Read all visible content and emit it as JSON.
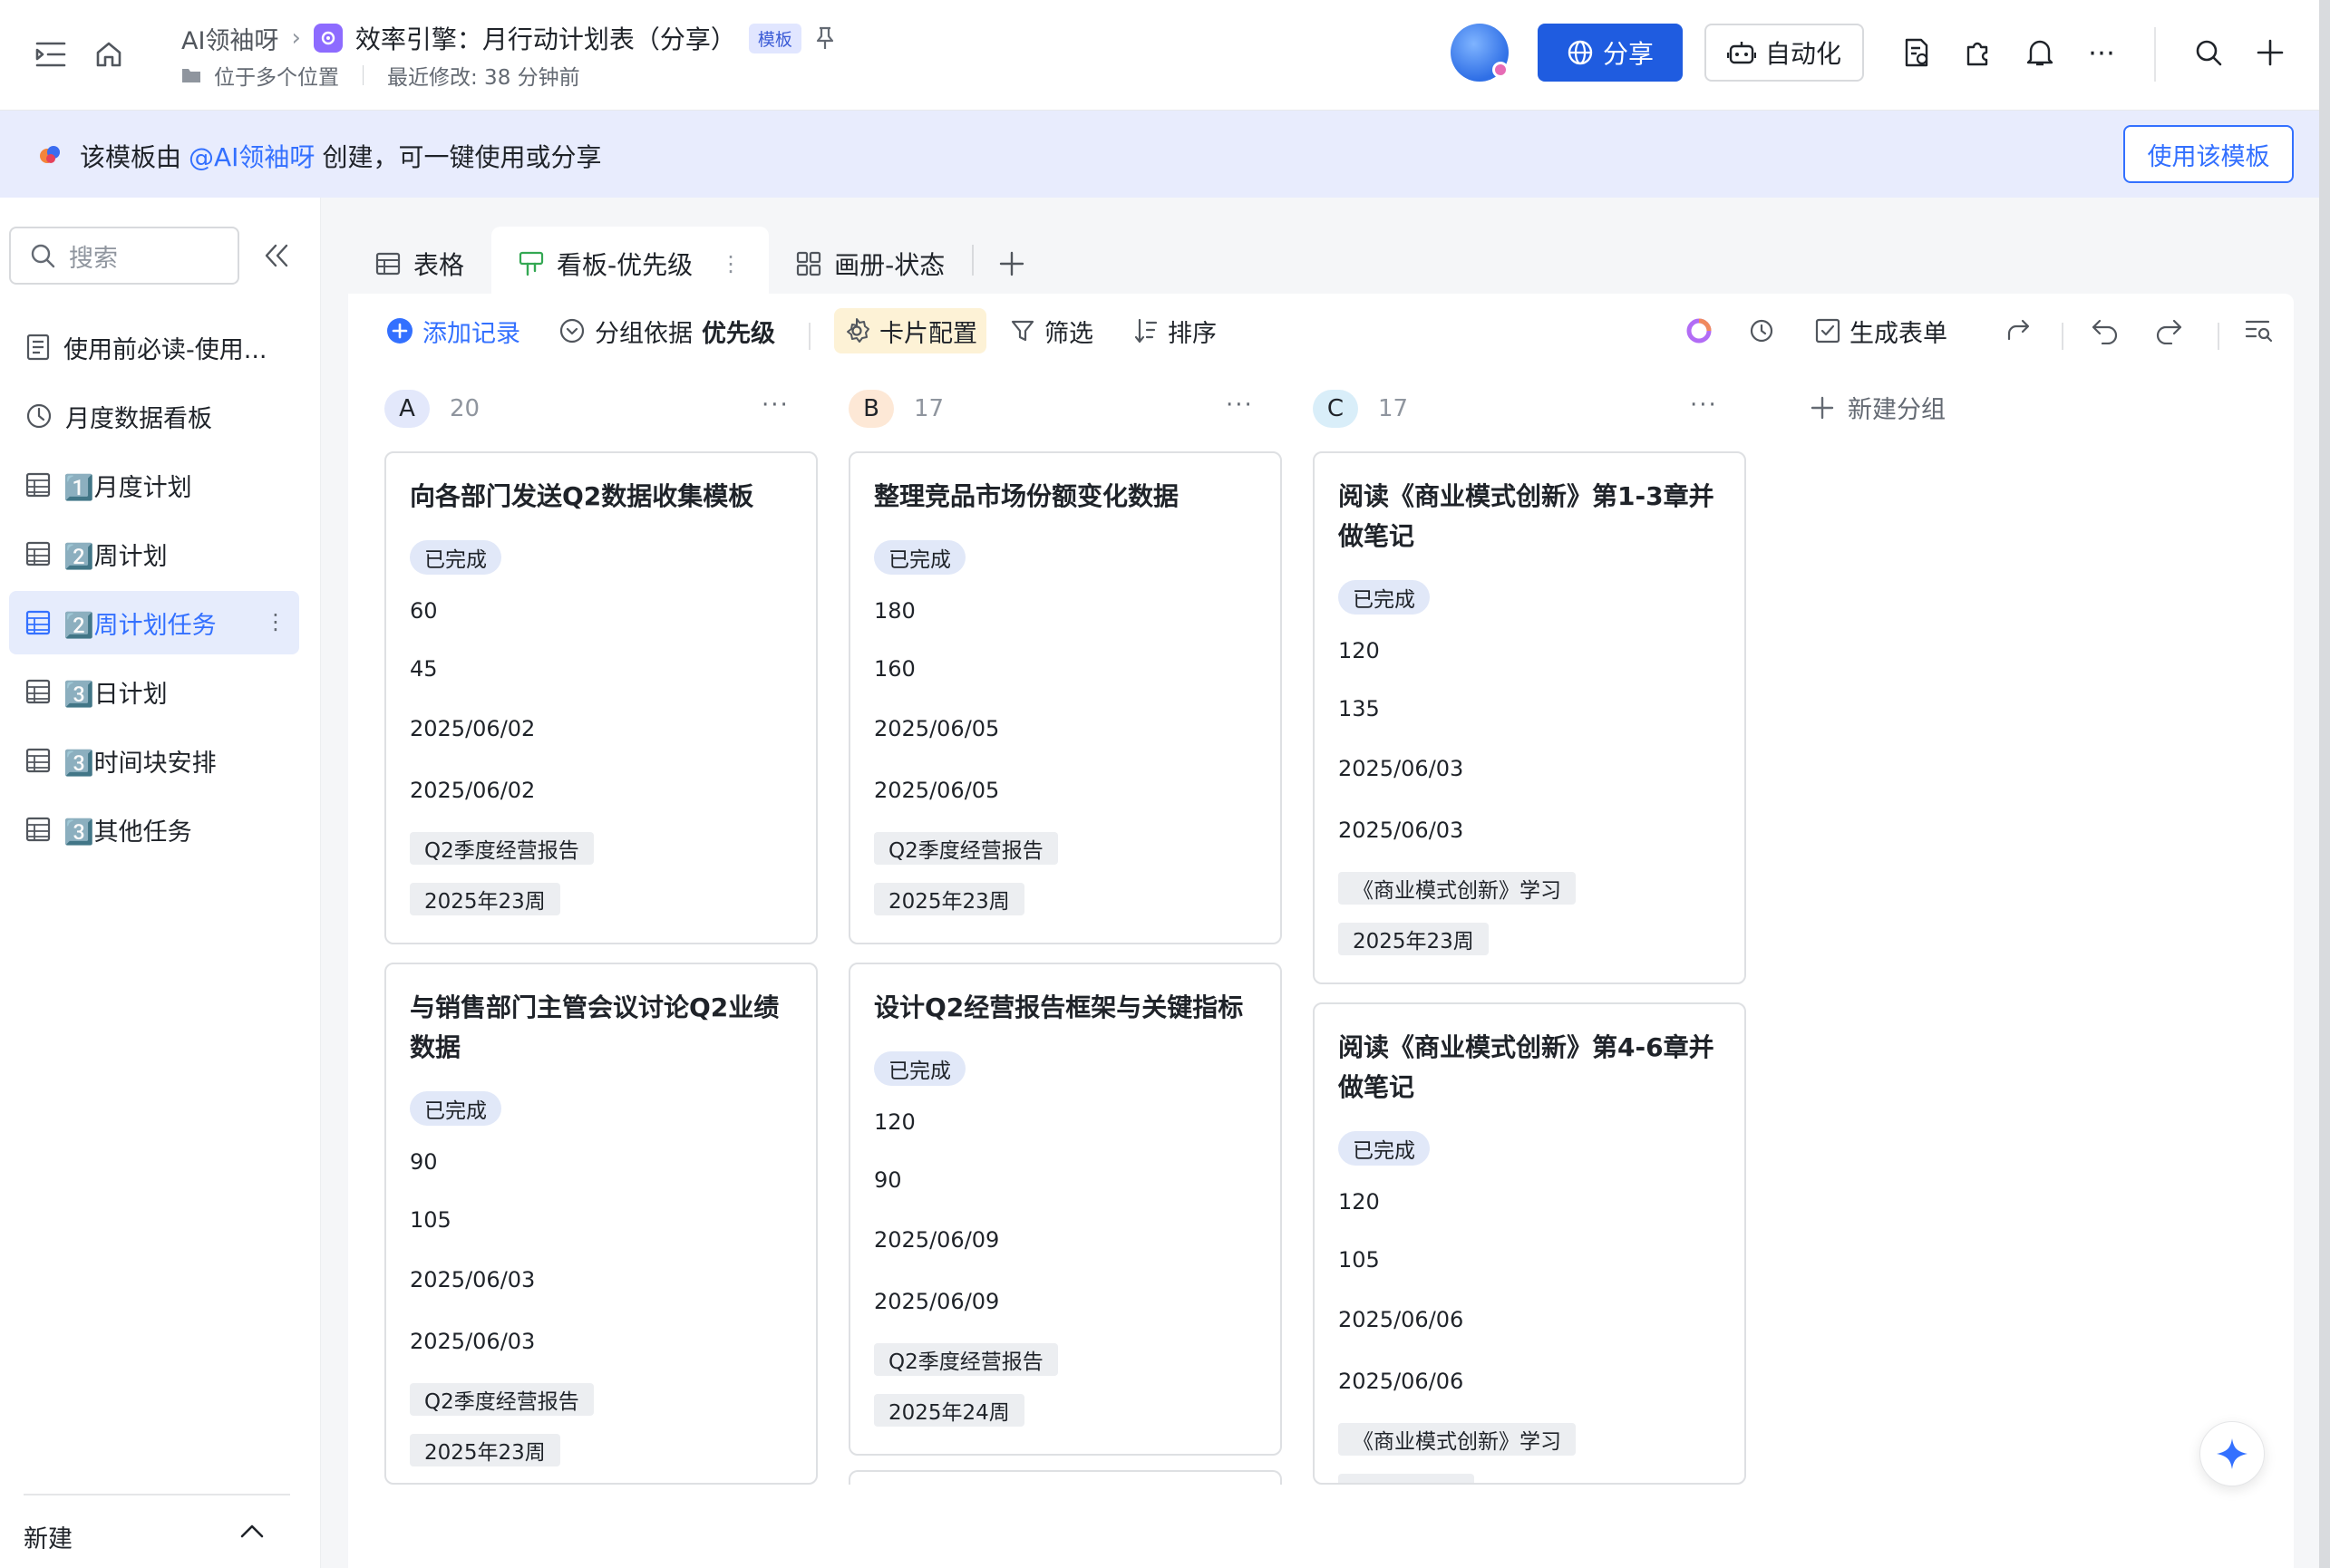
{
  "header": {
    "breadcrumb_parent": "AI领袖呀",
    "doc_title": "效率引擎：月行动计划表（分享）",
    "template_badge": "模板",
    "location_text": "位于多个位置",
    "last_modified": "最近修改: 38 分钟前",
    "share_label": "分享",
    "automation_label": "自动化"
  },
  "banner": {
    "prefix": "该模板由",
    "mention": "@AI领袖呀",
    "suffix": "创建，可一键使用或分享",
    "use_button": "使用该模板"
  },
  "sidebar": {
    "search_placeholder": "搜索",
    "items": [
      {
        "label": "使用前必读-使用..."
      },
      {
        "label": "月度数据看板"
      },
      {
        "label": "1️⃣月度计划"
      },
      {
        "label": "2️⃣周计划"
      },
      {
        "label": "2️⃣周计划任务"
      },
      {
        "label": "3️⃣日计划"
      },
      {
        "label": "3️⃣时间块安排"
      },
      {
        "label": "3️⃣其他任务"
      }
    ],
    "new_label": "新建"
  },
  "tabs": [
    {
      "label": "表格"
    },
    {
      "label": "看板-优先级"
    },
    {
      "label": "画册-状态"
    }
  ],
  "toolbar": {
    "add_record": "添加记录",
    "group_by_prefix": "分组依据",
    "group_by_value": "优先级",
    "card_config": "卡片配置",
    "filter": "筛选",
    "sort": "排序",
    "generate_form": "生成表单"
  },
  "columns": [
    {
      "key": "A",
      "count": "20",
      "color": "#e3e8fb",
      "cards": [
        {
          "title": "向各部门发送Q2数据收集模板",
          "status": "已完成",
          "n1": "60",
          "n2": "45",
          "d1": "2025/06/02",
          "d2": "2025/06/02",
          "tag1": "Q2季度经营报告",
          "tag2": "2025年23周"
        },
        {
          "title": "与销售部门主管会议讨论Q2业绩数据",
          "status": "已完成",
          "n1": "90",
          "n2": "105",
          "d1": "2025/06/03",
          "d2": "2025/06/03",
          "tag1": "Q2季度经营报告",
          "tag2": "2025年23周"
        }
      ]
    },
    {
      "key": "B",
      "count": "17",
      "color": "#fde8d6",
      "cards": [
        {
          "title": "整理竞品市场份额变化数据",
          "status": "已完成",
          "n1": "180",
          "n2": "160",
          "d1": "2025/06/05",
          "d2": "2025/06/05",
          "tag1": "Q2季度经营报告",
          "tag2": "2025年23周"
        },
        {
          "title": "设计Q2经营报告框架与关键指标",
          "status": "已完成",
          "n1": "120",
          "n2": "90",
          "d1": "2025/06/09",
          "d2": "2025/06/09",
          "tag1": "Q2季度经营报告",
          "tag2": "2025年24周"
        }
      ]
    },
    {
      "key": "C",
      "count": "17",
      "color": "#d9eef9",
      "cards": [
        {
          "title": "阅读《商业模式创新》第1-3章并做笔记",
          "status": "已完成",
          "n1": "120",
          "n2": "135",
          "d1": "2025/06/03",
          "d2": "2025/06/03",
          "tag1": "《商业模式创新》学习",
          "tag2": "2025年23周"
        },
        {
          "title": "阅读《商业模式创新》第4-6章并做笔记",
          "status": "已完成",
          "n1": "120",
          "n2": "105",
          "d1": "2025/06/06",
          "d2": "2025/06/06",
          "tag1": "《商业模式创新》学习",
          "tag2": ""
        }
      ]
    }
  ],
  "new_group_label": "新建分组",
  "colors": {
    "accent": "#3370ff",
    "share_button": "#1f5ce0",
    "banner_bg": "#e8ecfd"
  }
}
